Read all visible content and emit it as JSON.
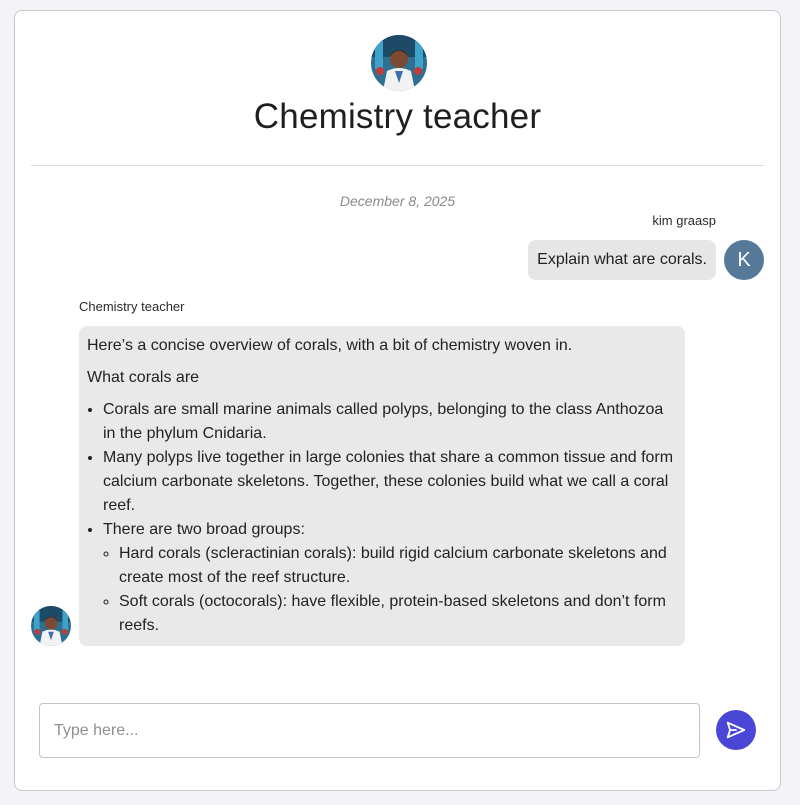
{
  "header": {
    "title": "Chemistry teacher",
    "avatar_icon": "teacher-avatar-icon"
  },
  "conversation": {
    "date": "December 8, 2025",
    "user_message": {
      "author": "kim graasp",
      "avatar_initial": "K",
      "avatar_color": "#56799a",
      "text": "Explain what are corals."
    },
    "bot_message": {
      "author": "Chemistry teacher",
      "intro": "Here’s a concise overview of corals, with a bit of chemistry woven in.",
      "section_title": "What corals are",
      "bullets": [
        "Corals are small marine animals called polyps, belonging to the class Anthozoa in the phylum Cnidaria.",
        "Many polyps live together in large colonies that share a common tissue and form calcium carbonate skeletons. Together, these colonies build what we call a coral reef.",
        "There are two broad groups:"
      ],
      "sub_bullets": [
        "Hard corals (scleractinian corals): build rigid calcium carbonate skeletons and create most of the reef structure.",
        "Soft corals (octocorals): have flexible, protein-based skeletons and don’t form reefs."
      ]
    }
  },
  "composer": {
    "placeholder": "Type here...",
    "value": "",
    "send_icon": "send-icon",
    "send_color": "#4a47d6"
  }
}
